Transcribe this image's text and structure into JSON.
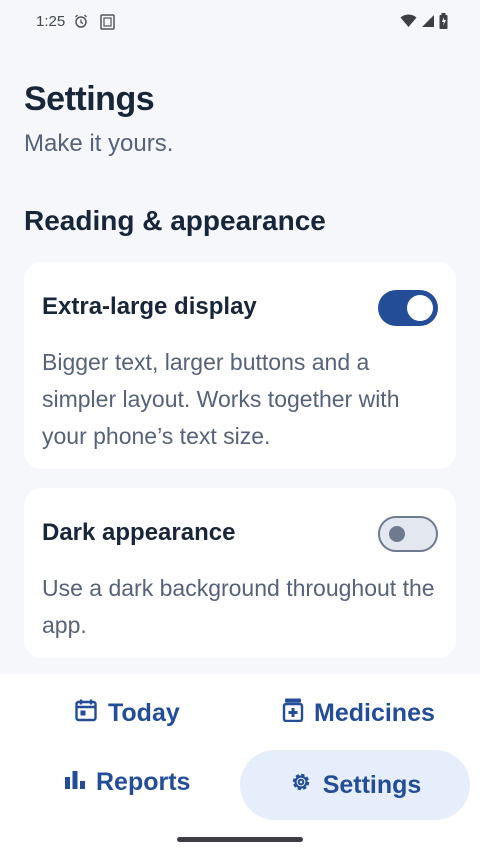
{
  "status_bar": {
    "time": "1:25",
    "icons": [
      "alarm-icon",
      "screen-icon",
      "wifi-icon",
      "signal-icon",
      "battery-icon"
    ]
  },
  "header": {
    "title": "Settings",
    "subtitle": "Make it yours."
  },
  "section": {
    "title": "Reading & appearance"
  },
  "settings": [
    {
      "title": "Extra-large display",
      "description": "Bigger text, larger buttons and a simpler layout. Works together with your phone’s text size.",
      "enabled": true
    },
    {
      "title": "Dark appearance",
      "description": "Use a dark background throughout the app.",
      "enabled": false
    }
  ],
  "nav": {
    "today": "Today",
    "medicines": "Medicines",
    "reports": "Reports",
    "settings": "Settings",
    "active": "settings"
  },
  "colors": {
    "accent": "#234d96",
    "background": "#f5f7fb",
    "active_nav_bg": "#e6eefb"
  }
}
